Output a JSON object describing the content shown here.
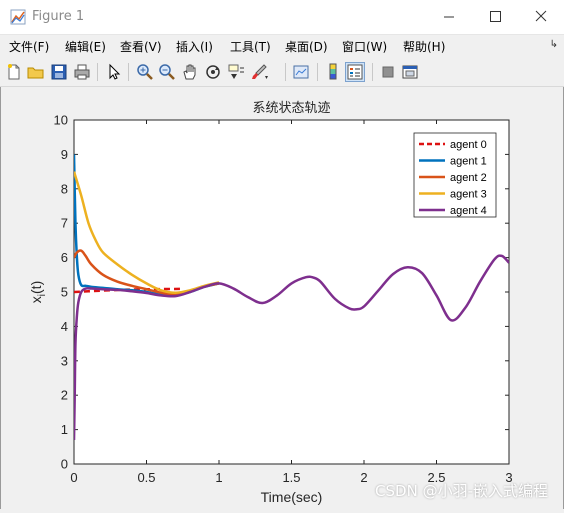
{
  "window": {
    "title": "Figure 1",
    "icon": "matlab-figure-icon"
  },
  "menu": [
    "文件(F)",
    "编辑(E)",
    "查看(V)",
    "插入(I)",
    "工具(T)",
    "桌面(D)",
    "窗口(W)",
    "帮助(H)"
  ],
  "toolbar": [
    "new-figure-icon",
    "open-file-icon",
    "save-icon",
    "print-icon",
    "arrow-pointer-icon",
    "zoom-in-icon",
    "zoom-out-icon",
    "pan-hand-icon",
    "rotate-3d-icon",
    "data-cursor-icon",
    "brush-icon",
    "link-plot-icon",
    "colorbar-icon",
    "legend-icon",
    "hide-plot-tools-icon",
    "show-plot-tools-icon"
  ],
  "watermark": "CSDN @小羽-嵌入式编程",
  "chart_data": {
    "type": "line",
    "title": "系统状态轨迹",
    "xlabel": "Time(sec)",
    "ylabel_main": "x",
    "ylabel_sub": "i",
    "ylabel_tail": "(t)",
    "xlim": [
      0,
      3
    ],
    "ylim": [
      0,
      10
    ],
    "xticks": [
      0,
      0.5,
      1,
      1.5,
      2,
      2.5,
      3
    ],
    "xtick_labels": [
      "0",
      "0.5",
      "1",
      "1.5",
      "2",
      "2.5",
      "3"
    ],
    "yticks": [
      0,
      1,
      2,
      3,
      4,
      5,
      6,
      7,
      8,
      9,
      10
    ],
    "ytick_labels": [
      "0",
      "1",
      "2",
      "3",
      "4",
      "5",
      "6",
      "7",
      "8",
      "9",
      "10"
    ],
    "grid": false,
    "legend_position": "top-right",
    "series": [
      {
        "name": "agent 0",
        "color": "#dd1111",
        "dash": true,
        "x": [
          0,
          0.1,
          0.3,
          0.5,
          0.75
        ],
        "y": [
          5.0,
          5.02,
          5.06,
          5.08,
          5.09
        ]
      },
      {
        "name": "agent 1",
        "color": "#0072bd",
        "dash": false,
        "x": [
          0,
          0.01,
          0.02,
          0.03,
          0.05,
          0.08,
          0.12,
          0.2,
          0.3,
          0.4,
          0.5,
          0.6,
          0.7,
          0.8,
          0.9,
          1.0
        ],
        "y": [
          9.0,
          7.0,
          6.0,
          5.5,
          5.2,
          5.18,
          5.15,
          5.12,
          5.08,
          5.05,
          5.0,
          4.92,
          4.9,
          5.0,
          5.15,
          5.25
        ]
      },
      {
        "name": "agent 2",
        "color": "#d95319",
        "dash": false,
        "x": [
          0,
          0.02,
          0.05,
          0.08,
          0.12,
          0.2,
          0.3,
          0.4,
          0.5,
          0.6,
          0.7,
          0.8,
          0.9,
          1.0
        ],
        "y": [
          6.0,
          6.15,
          6.2,
          6.05,
          5.8,
          5.5,
          5.3,
          5.18,
          5.08,
          4.98,
          4.92,
          5.02,
          5.16,
          5.25
        ]
      },
      {
        "name": "agent 3",
        "color": "#edb120",
        "dash": false,
        "x": [
          0,
          0.05,
          0.1,
          0.15,
          0.2,
          0.3,
          0.4,
          0.5,
          0.6,
          0.7,
          0.8,
          0.9,
          1.0
        ],
        "y": [
          8.5,
          7.8,
          7.0,
          6.5,
          6.15,
          5.8,
          5.5,
          5.25,
          5.05,
          4.98,
          5.05,
          5.18,
          5.28
        ]
      },
      {
        "name": "agent 4",
        "color": "#7e2f8e",
        "dash": false,
        "x": [
          0,
          0.005,
          0.01,
          0.02,
          0.03,
          0.05,
          0.08,
          0.12,
          0.2,
          0.3,
          0.4,
          0.5,
          0.6,
          0.7,
          0.8,
          0.9,
          1.0,
          1.1,
          1.2,
          1.3,
          1.4,
          1.5,
          1.6,
          1.65,
          1.7,
          1.8,
          1.9,
          1.95,
          2.0,
          2.1,
          2.2,
          2.3,
          2.4,
          2.5,
          2.6,
          2.7,
          2.8,
          2.9,
          2.95,
          3.0
        ],
        "y": [
          0.7,
          2.0,
          3.5,
          4.3,
          4.7,
          5.0,
          5.1,
          5.1,
          5.08,
          5.06,
          5.02,
          4.97,
          4.9,
          4.88,
          5.0,
          5.15,
          5.25,
          5.1,
          4.85,
          4.68,
          4.9,
          5.25,
          5.43,
          5.42,
          5.3,
          4.8,
          4.52,
          4.5,
          4.58,
          5.05,
          5.52,
          5.72,
          5.55,
          4.9,
          4.18,
          4.55,
          5.3,
          5.95,
          6.05,
          5.85
        ]
      }
    ]
  }
}
